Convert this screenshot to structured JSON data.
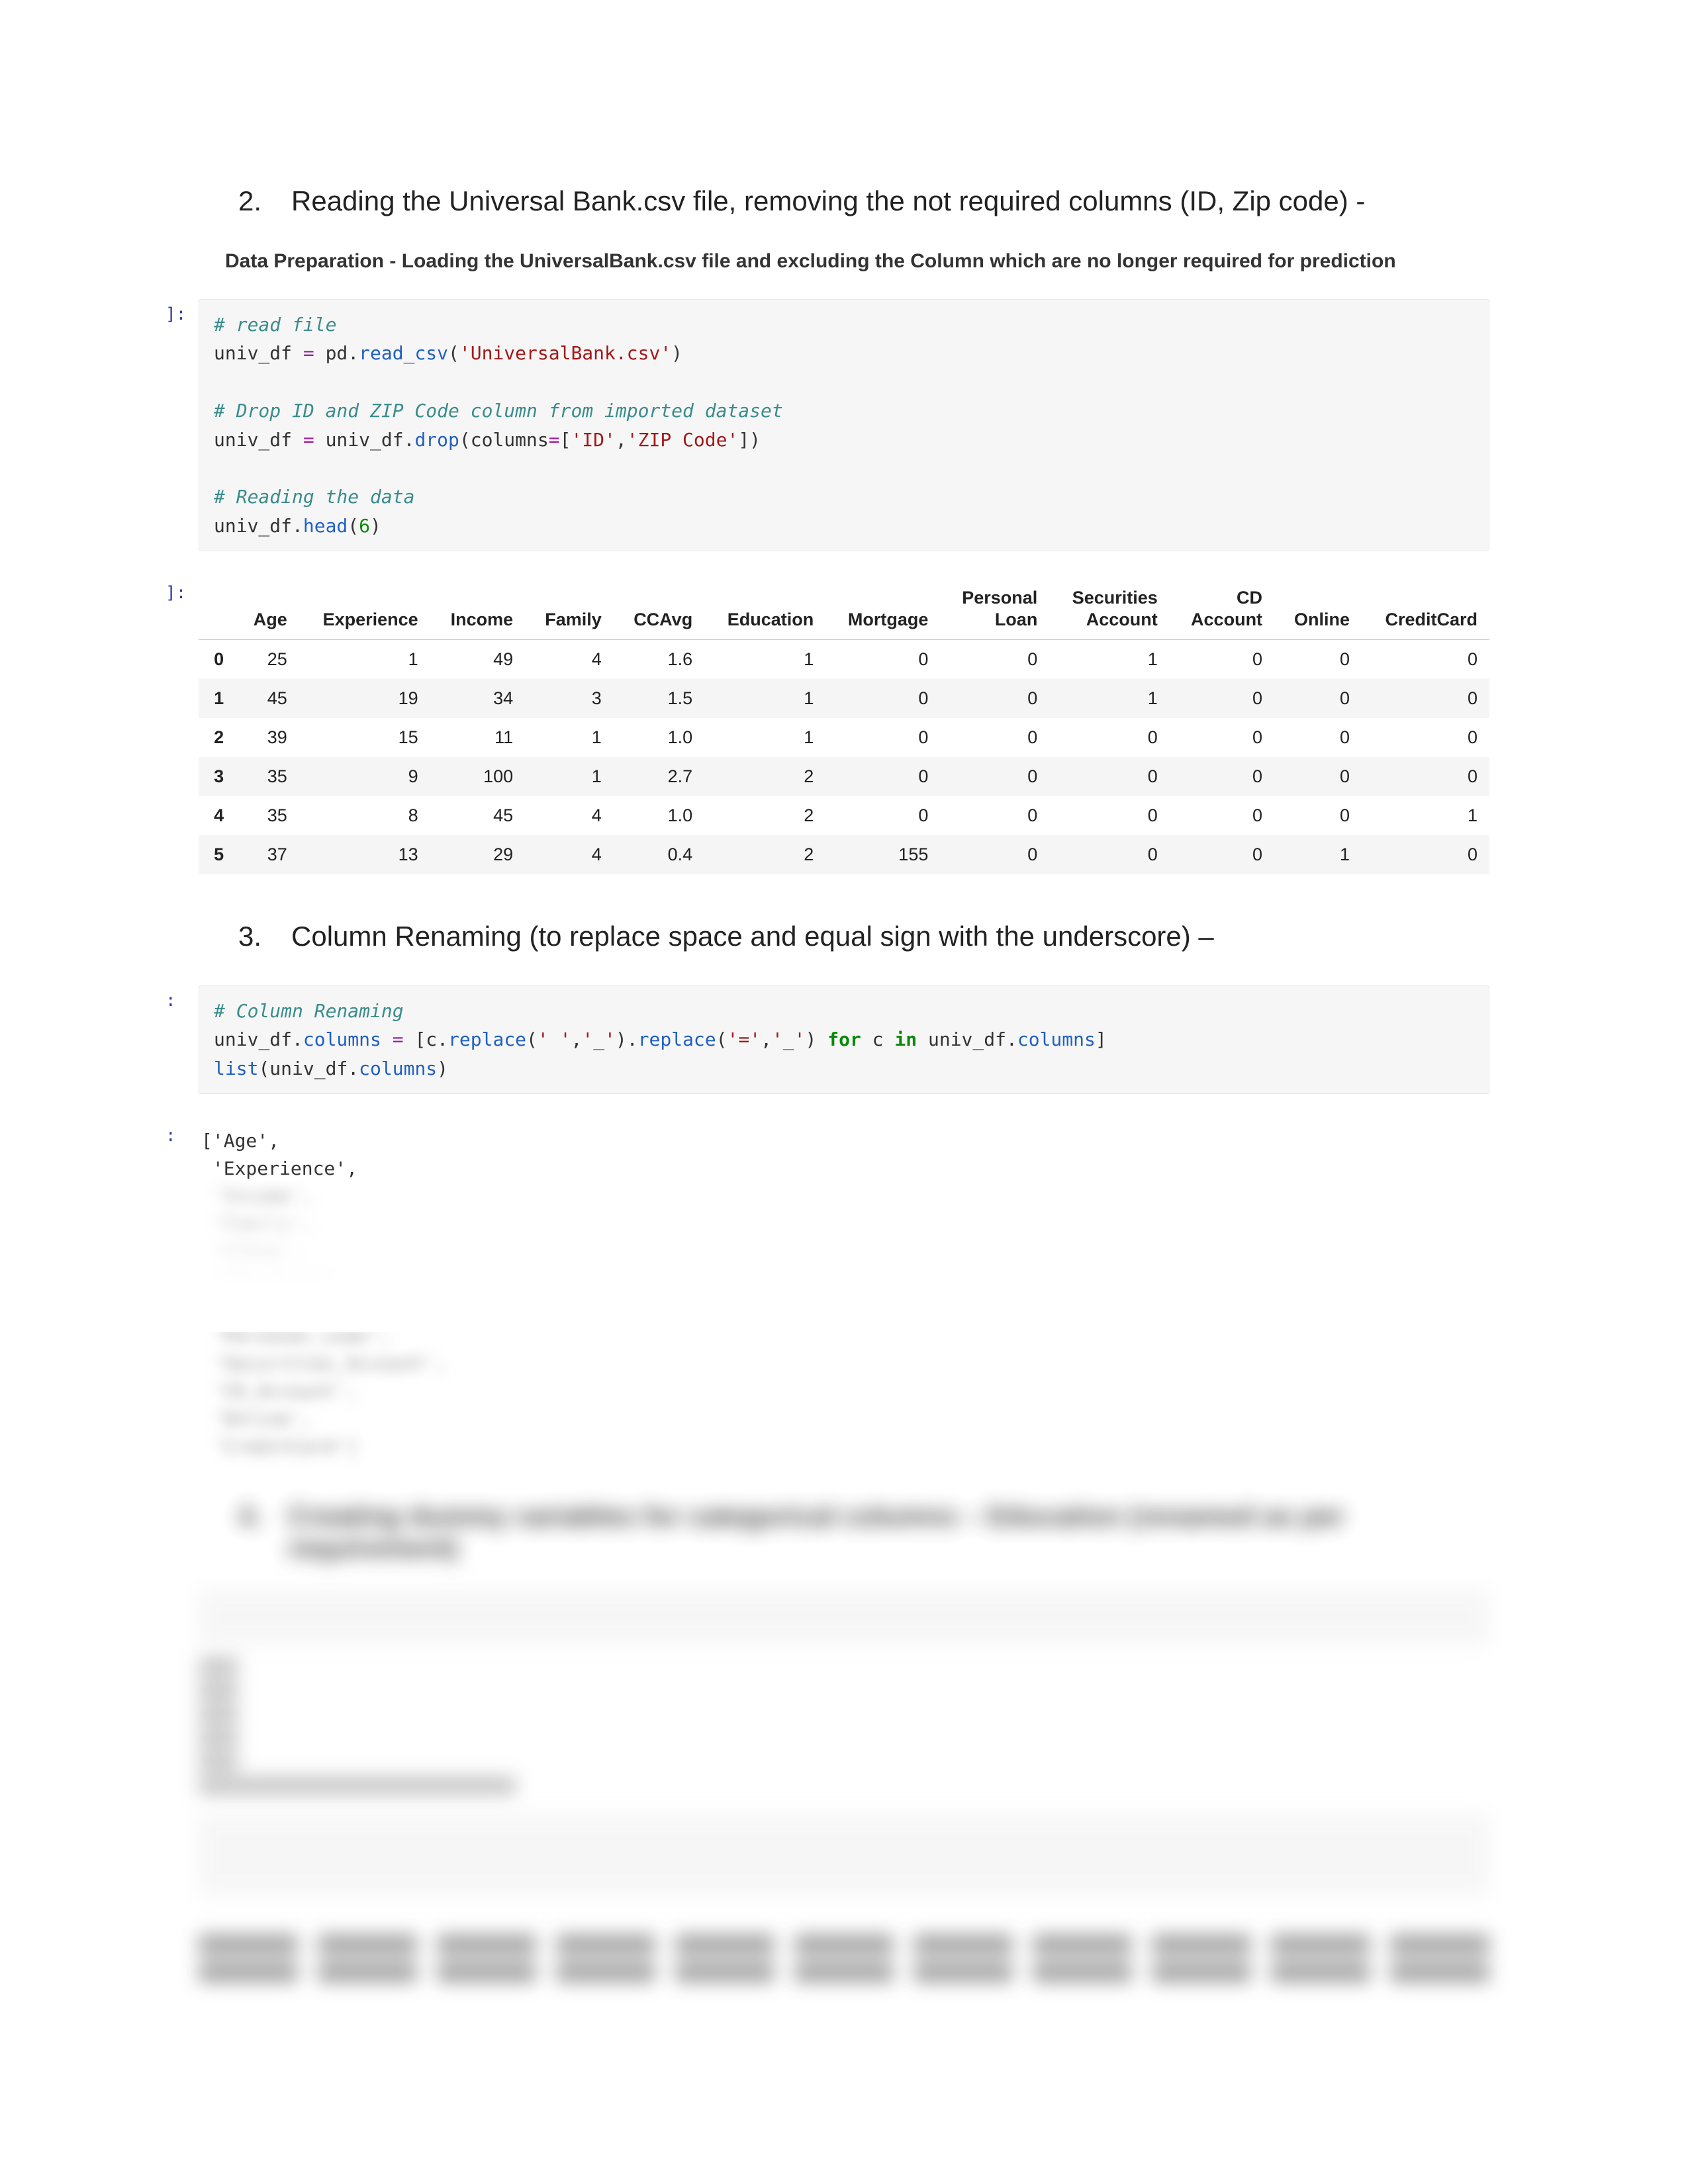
{
  "section2": {
    "number": "2.",
    "title": "Reading the Universal Bank.csv file, removing the not required columns (ID, Zip code) -",
    "desc": "Data Preparation - Loading the UniversalBank.csv file and excluding the Column which are no longer required for prediction"
  },
  "code1": {
    "prompt": "]:",
    "c1": "# read file",
    "l2a": "univ_df ",
    "l2op": "=",
    "l2b": " pd.",
    "l2f": "read_csv",
    "l2c": "(",
    "l2s": "'UniversalBank.csv'",
    "l2d": ")",
    "c2": "# Drop ID and ZIP Code column from imported dataset",
    "l4a": "univ_df ",
    "l4op": "=",
    "l4b": " univ_df.",
    "l4f": "drop",
    "l4c": "(columns",
    "l4op2": "=",
    "l4d": "[",
    "l4s1": "'ID'",
    "l4e": ",",
    "l4s2": "'ZIP Code'",
    "l4f2": "])",
    "c3": "# Reading the data",
    "l6a": "univ_df.",
    "l6f": "head",
    "l6b": "(",
    "l6n": "6",
    "l6c": ")"
  },
  "table1": {
    "prompt": "]:",
    "headers": [
      "",
      "Age",
      "Experience",
      "Income",
      "Family",
      "CCAvg",
      "Education",
      "Mortgage",
      "Personal\nLoan",
      "Securities\nAccount",
      "CD\nAccount",
      "Online",
      "CreditCard"
    ],
    "rows": [
      [
        "0",
        "25",
        "1",
        "49",
        "4",
        "1.6",
        "1",
        "0",
        "0",
        "1",
        "0",
        "0",
        "0"
      ],
      [
        "1",
        "45",
        "19",
        "34",
        "3",
        "1.5",
        "1",
        "0",
        "0",
        "1",
        "0",
        "0",
        "0"
      ],
      [
        "2",
        "39",
        "15",
        "11",
        "1",
        "1.0",
        "1",
        "0",
        "0",
        "0",
        "0",
        "0",
        "0"
      ],
      [
        "3",
        "35",
        "9",
        "100",
        "1",
        "2.7",
        "2",
        "0",
        "0",
        "0",
        "0",
        "0",
        "0"
      ],
      [
        "4",
        "35",
        "8",
        "45",
        "4",
        "1.0",
        "2",
        "0",
        "0",
        "0",
        "0",
        "0",
        "1"
      ],
      [
        "5",
        "37",
        "13",
        "29",
        "4",
        "0.4",
        "2",
        "155",
        "0",
        "0",
        "0",
        "1",
        "0"
      ]
    ]
  },
  "section3": {
    "number": "3.",
    "title": "Column Renaming (to replace space and equal sign with the underscore) –"
  },
  "code2": {
    "prompt": ":",
    "c1": "# Column Renaming",
    "l2a": "univ_df.",
    "l2f": "columns",
    "l2b": " ",
    "l2op": "=",
    "l2c": " [c.",
    "l2f2": "replace",
    "l2d": "(",
    "l2s1": "' '",
    "l2e": ",",
    "l2s2": "'_'",
    "l2f3": ").",
    "l2f4": "replace",
    "l2g": "(",
    "l2s3": "'='",
    "l2h": ",",
    "l2s4": "'_'",
    "l2i": ") ",
    "l2k": "for",
    "l2j": " c ",
    "l2k2": "in",
    "l2l": " univ_df.",
    "l2f5": "columns",
    "l2m": "]",
    "l3a": "list",
    "l3b": "(univ_df.",
    "l3f": "columns",
    "l3c": ")"
  },
  "out2": {
    "prompt": ":",
    "line1": "['Age',",
    "line2": " 'Experience',",
    "line3_blur": " 'Income',"
  },
  "blurred_section": {
    "number": "4.",
    "title": "Creating dummy variables for categorical columns – Education (renamed as per requirement)"
  }
}
